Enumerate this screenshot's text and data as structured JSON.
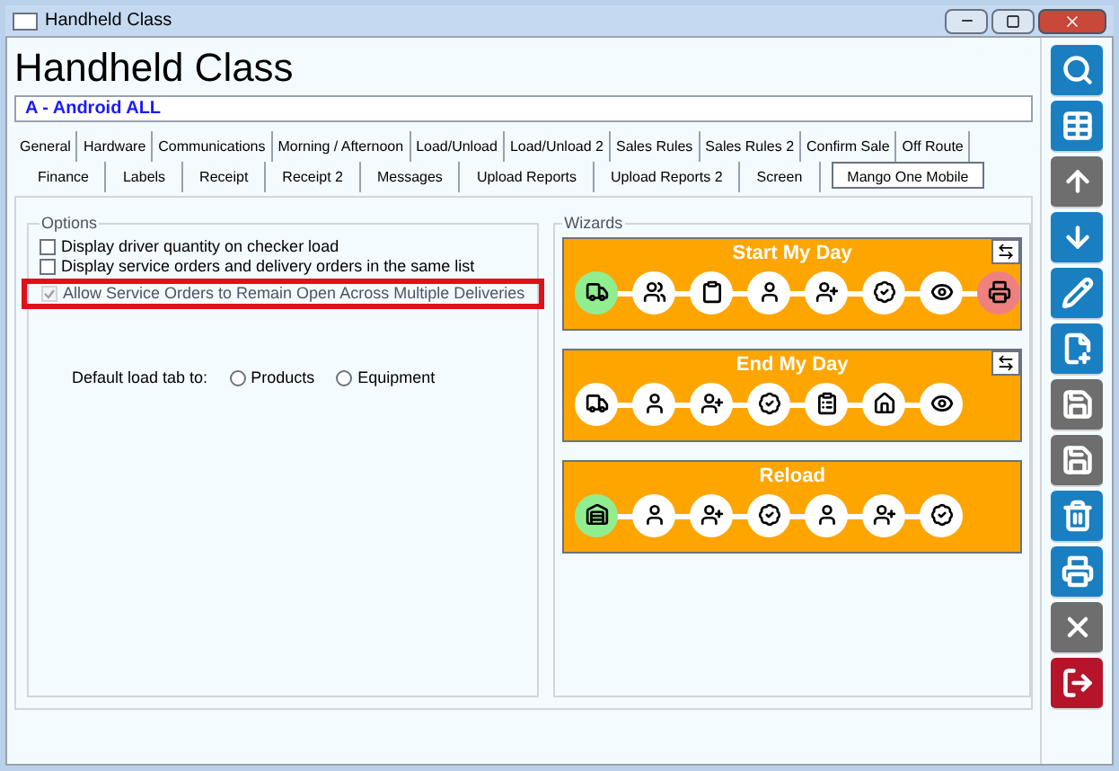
{
  "window": {
    "title": "Handheld Class"
  },
  "header": {
    "title": "Handheld Class",
    "subtitle": "A - Android ALL"
  },
  "tab_rows": [
    [
      {
        "label": "General",
        "selected": false
      },
      {
        "label": "Hardware",
        "selected": false
      },
      {
        "label": "Communications",
        "selected": false
      },
      {
        "label": "Morning / Afternoon",
        "selected": false
      },
      {
        "label": "Load/Unload",
        "selected": false
      },
      {
        "label": "Load/Unload 2",
        "selected": false
      },
      {
        "label": "Sales Rules",
        "selected": false
      },
      {
        "label": "Sales Rules 2",
        "selected": false
      },
      {
        "label": "Confirm Sale",
        "selected": false
      },
      {
        "label": "Off Route",
        "selected": false
      }
    ],
    [
      {
        "label": "Finance",
        "selected": false
      },
      {
        "label": "Labels",
        "selected": false
      },
      {
        "label": "Receipt",
        "selected": false
      },
      {
        "label": "Receipt 2",
        "selected": false
      },
      {
        "label": "Messages",
        "selected": false
      },
      {
        "label": "Upload Reports",
        "selected": false
      },
      {
        "label": "Upload Reports 2",
        "selected": false
      },
      {
        "label": "Screen",
        "selected": false
      },
      {
        "label": "Mango One Mobile",
        "selected": true
      }
    ]
  ],
  "options": {
    "title": "Options",
    "items": [
      {
        "label": "Display driver quantity on checker load",
        "checked": false,
        "disabled": false,
        "highlighted": false
      },
      {
        "label": "Display service orders and delivery orders in the same list",
        "checked": false,
        "disabled": false,
        "highlighted": false
      },
      {
        "label": "Allow Service Orders to Remain Open Across Multiple Deliveries",
        "checked": true,
        "disabled": true,
        "highlighted": true
      }
    ],
    "default_load_tab": {
      "label": "Default load tab to:",
      "choices": [
        {
          "label": "Products",
          "selected": false
        },
        {
          "label": "Equipment",
          "selected": false
        }
      ]
    }
  },
  "wizards": {
    "title": "Wizards",
    "items": [
      {
        "title": "Start My Day",
        "has_reorder": true,
        "steps": [
          {
            "kind": "truck",
            "color": "#90ee90"
          },
          {
            "kind": "group",
            "color": "#ffffff"
          },
          {
            "kind": "clipboard",
            "color": "#ffffff"
          },
          {
            "kind": "person",
            "color": "#ffffff"
          },
          {
            "kind": "person-add",
            "color": "#ffffff"
          },
          {
            "kind": "badge",
            "color": "#ffffff"
          },
          {
            "kind": "eye",
            "color": "#ffffff"
          },
          {
            "kind": "printer",
            "color": "#f08080"
          }
        ]
      },
      {
        "title": "End My Day",
        "has_reorder": true,
        "steps": [
          {
            "kind": "truck",
            "color": "#ffffff"
          },
          {
            "kind": "person",
            "color": "#ffffff"
          },
          {
            "kind": "person-add",
            "color": "#ffffff"
          },
          {
            "kind": "badge",
            "color": "#ffffff"
          },
          {
            "kind": "list",
            "color": "#ffffff"
          },
          {
            "kind": "home",
            "color": "#ffffff"
          },
          {
            "kind": "eye",
            "color": "#ffffff"
          }
        ]
      },
      {
        "title": "Reload",
        "has_reorder": false,
        "steps": [
          {
            "kind": "warehouse",
            "color": "#90ee90"
          },
          {
            "kind": "person",
            "color": "#ffffff"
          },
          {
            "kind": "person-add",
            "color": "#ffffff"
          },
          {
            "kind": "badge",
            "color": "#ffffff"
          },
          {
            "kind": "person",
            "color": "#ffffff"
          },
          {
            "kind": "person-add",
            "color": "#ffffff"
          },
          {
            "kind": "badge",
            "color": "#ffffff"
          }
        ]
      }
    ]
  },
  "toolbar": [
    {
      "kind": "search",
      "color": "#1a7fc0"
    },
    {
      "kind": "grid",
      "color": "#1a7fc0"
    },
    {
      "kind": "up",
      "color": "#6e6e6e"
    },
    {
      "kind": "down",
      "color": "#1a7fc0"
    },
    {
      "kind": "edit",
      "color": "#1a7fc0"
    },
    {
      "kind": "copy",
      "color": "#1a7fc0"
    },
    {
      "kind": "save-new",
      "color": "#6e6e6e"
    },
    {
      "kind": "save",
      "color": "#6e6e6e"
    },
    {
      "kind": "delete",
      "color": "#1a7fc0"
    },
    {
      "kind": "print",
      "color": "#1a7fc0"
    },
    {
      "kind": "cancel",
      "color": "#6e6e6e"
    },
    {
      "kind": "exit",
      "color": "#b5142b"
    }
  ]
}
